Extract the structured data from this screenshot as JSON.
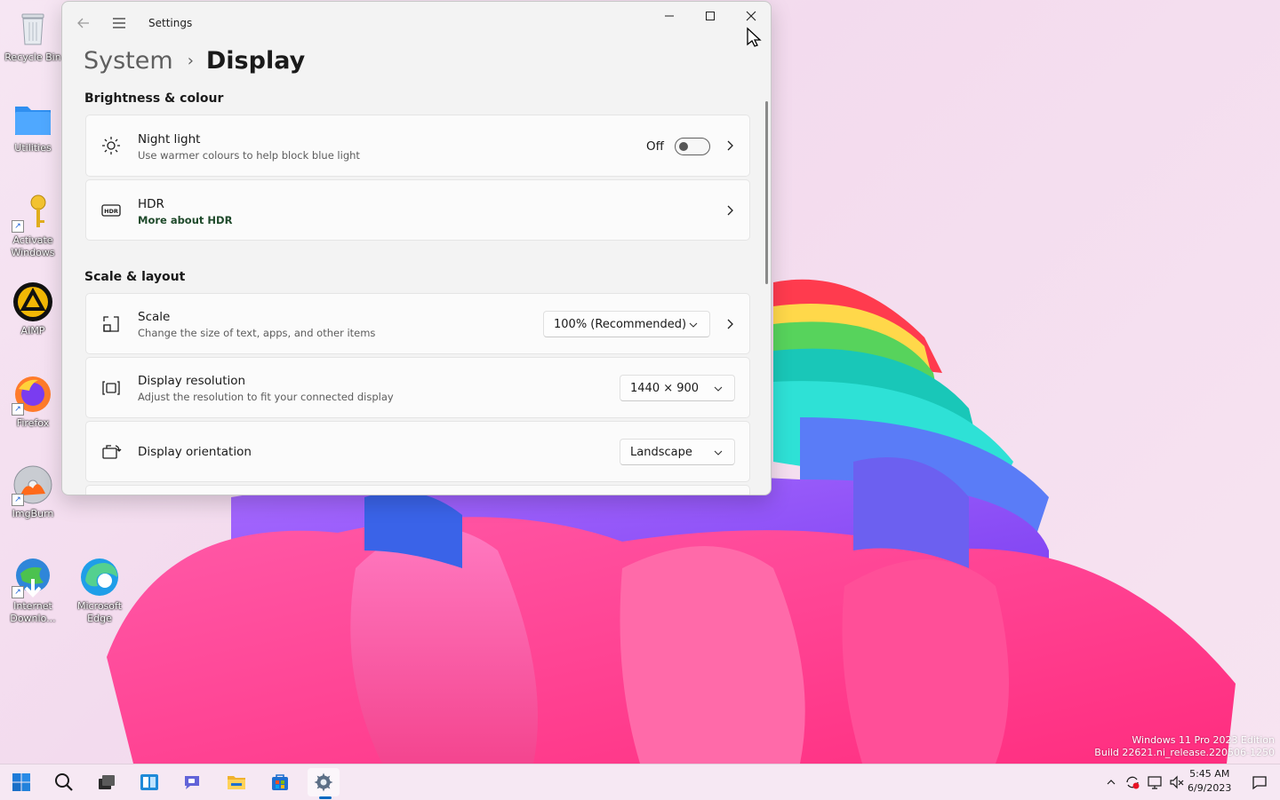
{
  "desktop": {
    "icons": [
      {
        "label": "Recycle Bin"
      },
      {
        "label": "Utilities"
      },
      {
        "label": "Activate Windows"
      },
      {
        "label": "AIMP"
      },
      {
        "label": "Firefox"
      },
      {
        "label": "ImgBurn"
      },
      {
        "label": "Internet Downlo..."
      },
      {
        "label": "Microsoft Edge"
      }
    ],
    "watermark_line1": "Windows 11 Pro 2023 Edition",
    "watermark_line2": "Build 22621.ni_release.220506-1250"
  },
  "window": {
    "app_title": "Settings",
    "breadcrumb_parent": "System",
    "breadcrumb_separator": "›",
    "breadcrumb_current": "Display",
    "sections": {
      "brightness_title": "Brightness & colour",
      "scale_title": "Scale & layout"
    },
    "night_light": {
      "title": "Night light",
      "subtitle": "Use warmer colours to help block blue light",
      "state_label": "Off"
    },
    "hdr": {
      "title": "HDR",
      "link": "More about HDR"
    },
    "scale": {
      "title": "Scale",
      "subtitle": "Change the size of text, apps, and other items",
      "value": "100% (Recommended)"
    },
    "resolution": {
      "title": "Display resolution",
      "subtitle": "Adjust the resolution to fit your connected display",
      "value": "1440 × 900"
    },
    "orientation": {
      "title": "Display orientation",
      "value": "Landscape"
    }
  },
  "taskbar": {
    "clock_time": "5:45 AM",
    "clock_date": "6/9/2023"
  },
  "colors": {
    "accent": "#0067c0",
    "window_bg": "#f3f3f3",
    "card_bg": "#fbfbfb"
  }
}
